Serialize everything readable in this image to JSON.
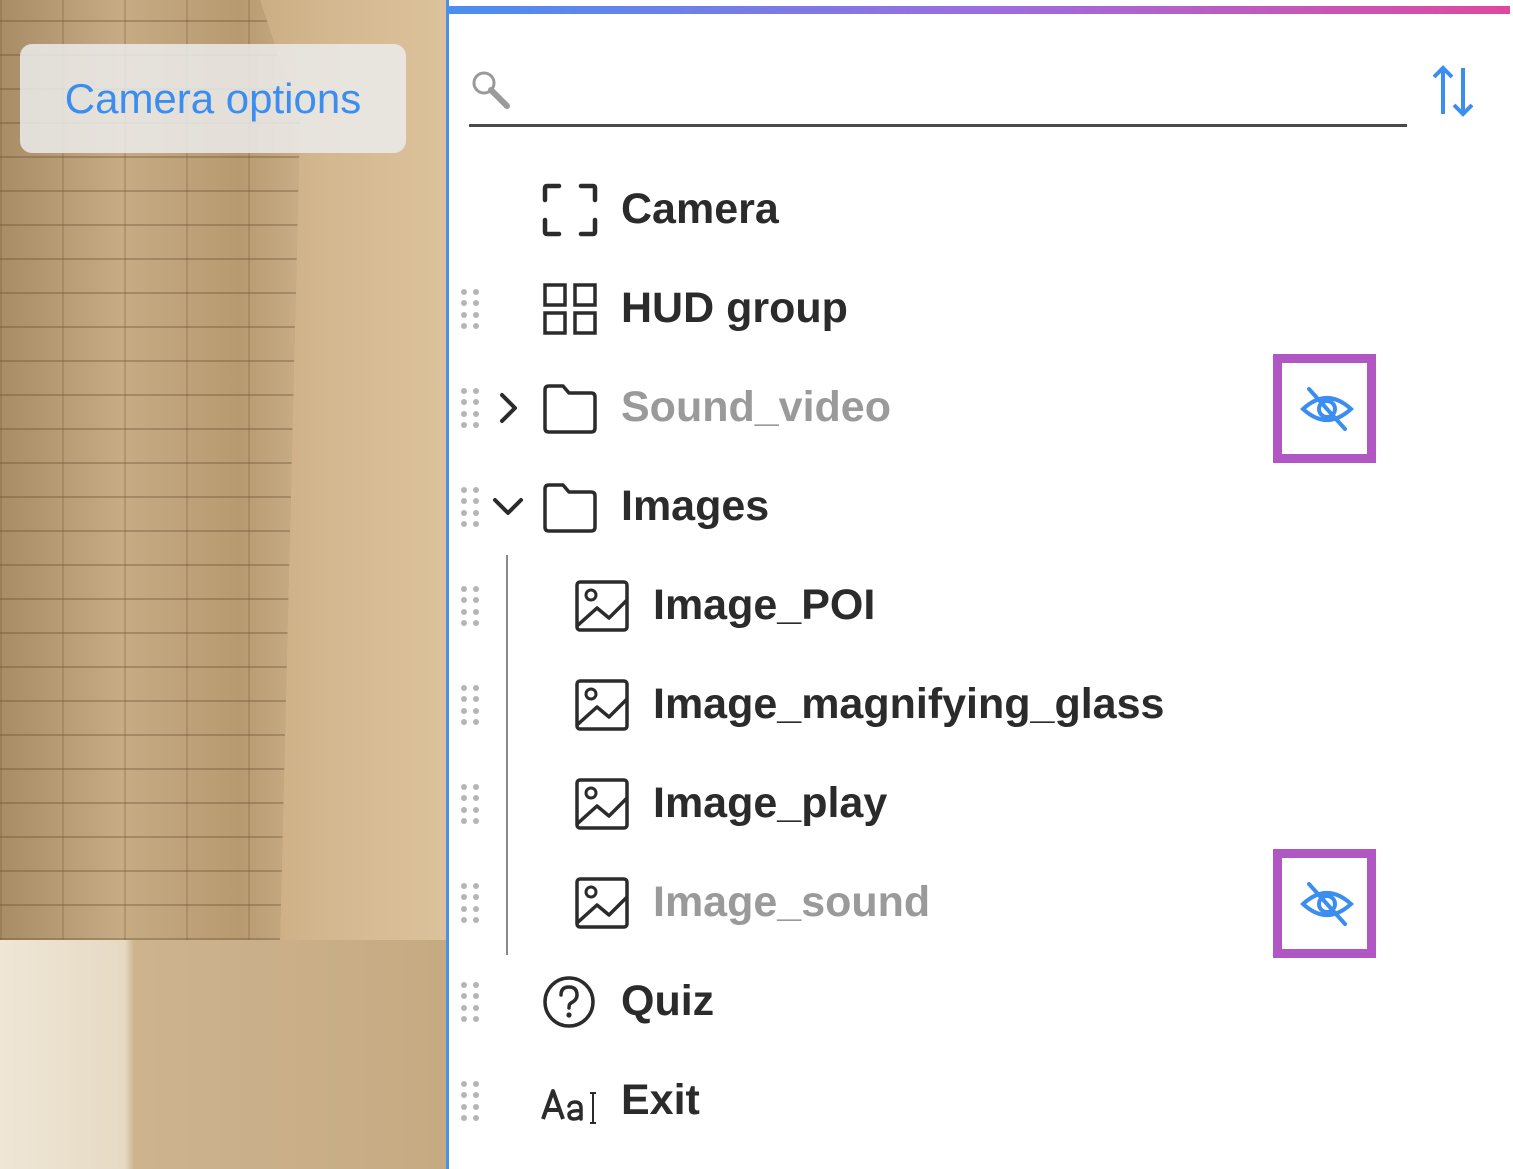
{
  "viewport": {
    "camera_options_label": "Camera options"
  },
  "outline": {
    "search": {
      "value": "",
      "placeholder": ""
    },
    "items": [
      {
        "label": "Camera",
        "icon": "camera-frame-icon",
        "hidden": false
      },
      {
        "label": "HUD group",
        "icon": "hud-grid-icon",
        "hidden": false
      },
      {
        "label": "Sound_video",
        "icon": "folder-icon",
        "hidden": true,
        "expanded": false
      },
      {
        "label": "Images",
        "icon": "folder-icon",
        "hidden": false,
        "expanded": true
      },
      {
        "label": "Image_POI",
        "icon": "image-icon",
        "hidden": false
      },
      {
        "label": "Image_magnifying_glass",
        "icon": "image-icon",
        "hidden": false
      },
      {
        "label": "Image_play",
        "icon": "image-icon",
        "hidden": false
      },
      {
        "label": "Image_sound",
        "icon": "image-icon",
        "hidden": true
      },
      {
        "label": "Quiz",
        "icon": "question-circle-icon",
        "hidden": false
      },
      {
        "label": "Exit",
        "icon": "text-aa-icon",
        "hidden": false
      }
    ]
  },
  "colors": {
    "accent": "#3b8ef0",
    "hidden_text": "#9a9a9a",
    "highlight_border": "#b157c4",
    "text": "#2b2b2b"
  }
}
